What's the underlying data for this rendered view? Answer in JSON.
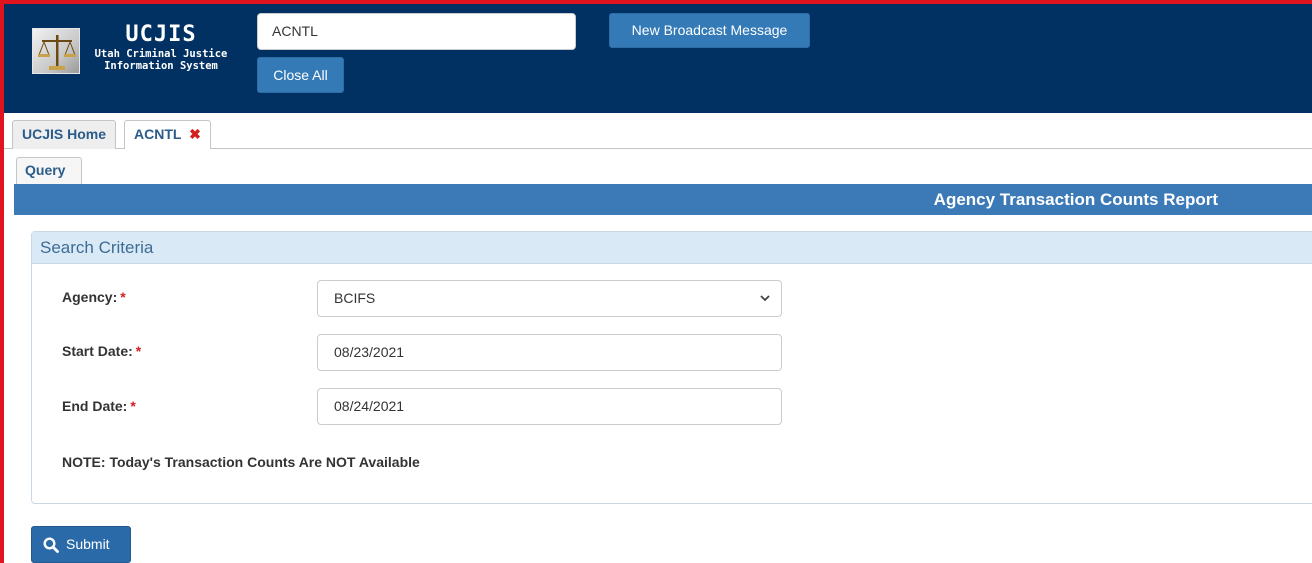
{
  "header": {
    "logo_title": "UCJIS",
    "logo_subtitle": "Utah Criminal Justice\nInformation System",
    "command_value": "ACNTL",
    "broadcast_label": "New Broadcast Message",
    "close_all_label": "Close All"
  },
  "tabs": [
    {
      "label": "UCJIS Home"
    },
    {
      "label": "ACNTL",
      "close_glyph": "✖"
    }
  ],
  "subtab": {
    "label": "Query"
  },
  "page_title": "Agency Transaction Counts Report",
  "search": {
    "heading": "Search Criteria",
    "agency_label": "Agency:",
    "agency_value": "BCIFS",
    "start_label": "Start Date:",
    "start_value": "08/23/2021",
    "end_label": "End Date:",
    "end_value": "08/24/2021",
    "required_mark": "*",
    "note": "NOTE: Today's Transaction Counts Are NOT Available"
  },
  "submit_label": "Submit",
  "colors": {
    "header_bg": "#003162",
    "accent": "#337ab7",
    "frame": "#e0141e"
  }
}
